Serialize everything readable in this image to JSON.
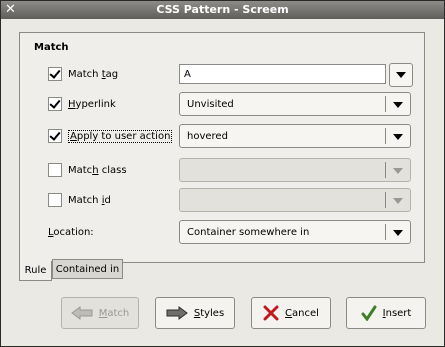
{
  "window": {
    "title": "CSS Pattern - Screem"
  },
  "section": {
    "title": "Match"
  },
  "rows": {
    "tag": {
      "label": "Match tag",
      "checked": true,
      "value": "A"
    },
    "hyperlink": {
      "label": "Hyperlink",
      "checked": true,
      "value": "Unvisited"
    },
    "action": {
      "label": "Apply to user action",
      "checked": true,
      "value": "hovered"
    },
    "class": {
      "label": "Match class",
      "checked": false,
      "value": ""
    },
    "id": {
      "label": "Match id",
      "checked": false,
      "value": ""
    }
  },
  "location": {
    "label": "Location:",
    "value": "Container somewhere in"
  },
  "tabs": [
    {
      "label": "Rule"
    },
    {
      "label": "Contained in"
    }
  ],
  "buttons": {
    "match": "Match",
    "styles": "Styles",
    "cancel": "Cancel",
    "insert": "Insert"
  },
  "icons": {
    "close": "close-icon",
    "match": "arrow-left-icon",
    "styles": "arrow-right-icon",
    "cancel": "cancel-x-icon",
    "insert": "checkmark-icon"
  }
}
